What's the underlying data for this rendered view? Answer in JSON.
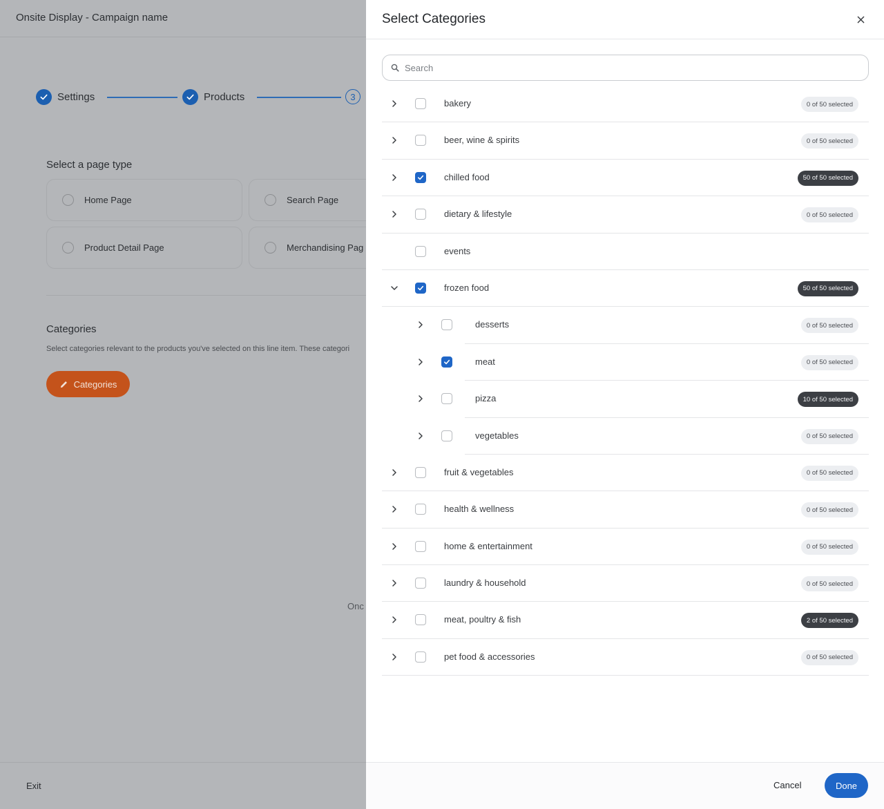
{
  "background": {
    "title": "Onsite Display - Campaign name",
    "steps": [
      {
        "label": "Settings",
        "state": "complete"
      },
      {
        "label": "Products",
        "state": "complete"
      },
      {
        "label": "",
        "number": "3",
        "state": "current"
      }
    ],
    "page_type_heading": "Select a page type",
    "page_types": [
      "Home Page",
      "Search Page",
      "Product Detail Page",
      "Merchandising Pag"
    ],
    "categories_heading": "Categories",
    "categories_description": "Select categories relevant to the products you've selected on this line item. These categori",
    "categories_button": "Categories",
    "once_text": "Onc",
    "exit_label": "Exit"
  },
  "drawer": {
    "title": "Select Categories",
    "search_placeholder": "Search",
    "rows": [
      {
        "label": "bakery",
        "level": 0,
        "expand": "right",
        "checked": false,
        "badge": "0 of 50 selected",
        "badge_dark": false
      },
      {
        "label": "beer, wine & spirits",
        "level": 0,
        "expand": "right",
        "checked": false,
        "badge": "0 of 50 selected",
        "badge_dark": false
      },
      {
        "label": "chilled food",
        "level": 0,
        "expand": "right",
        "checked": true,
        "badge": "50 of 50 selected",
        "badge_dark": true
      },
      {
        "label": "dietary & lifestyle",
        "level": 0,
        "expand": "right",
        "checked": false,
        "badge": "0 of 50 selected",
        "badge_dark": false
      },
      {
        "label": "events",
        "level": 0,
        "expand": "none",
        "checked": false,
        "badge": "",
        "badge_dark": false
      },
      {
        "label": "frozen food",
        "level": 0,
        "expand": "down",
        "checked": true,
        "badge": "50 of 50 selected",
        "badge_dark": true
      },
      {
        "label": "desserts",
        "level": 1,
        "expand": "right",
        "checked": false,
        "badge": "0 of 50 selected",
        "badge_dark": false
      },
      {
        "label": "meat",
        "level": 1,
        "expand": "right",
        "checked": true,
        "badge": "0 of 50 selected",
        "badge_dark": false
      },
      {
        "label": "pizza",
        "level": 1,
        "expand": "right",
        "checked": false,
        "badge": "10 of 50 selected",
        "badge_dark": true
      },
      {
        "label": "vegetables",
        "level": 1,
        "expand": "right",
        "checked": false,
        "badge": "0 of 50 selected",
        "badge_dark": false
      },
      {
        "label": "fruit & vegetables",
        "level": 0,
        "expand": "right",
        "checked": false,
        "badge": "0 of 50 selected",
        "badge_dark": false
      },
      {
        "label": "health & wellness",
        "level": 0,
        "expand": "right",
        "checked": false,
        "badge": "0 of 50 selected",
        "badge_dark": false
      },
      {
        "label": "home & entertainment",
        "level": 0,
        "expand": "right",
        "checked": false,
        "badge": "0 of 50 selected",
        "badge_dark": false
      },
      {
        "label": "laundry & household",
        "level": 0,
        "expand": "right",
        "checked": false,
        "badge": "0 of 50 selected",
        "badge_dark": false
      },
      {
        "label": "meat, poultry & fish",
        "level": 0,
        "expand": "right",
        "checked": false,
        "badge": "2 of 50 selected",
        "badge_dark": true
      },
      {
        "label": "pet food & accessories",
        "level": 0,
        "expand": "right",
        "checked": false,
        "badge": "0 of 50 selected",
        "badge_dark": false
      }
    ],
    "cancel_label": "Cancel",
    "done_label": "Done"
  },
  "colors": {
    "primary": "#1f66c7",
    "accent_orange": "#c4531b",
    "badge_dark": "#3c3f44",
    "overlay": "#b4b6b9"
  }
}
